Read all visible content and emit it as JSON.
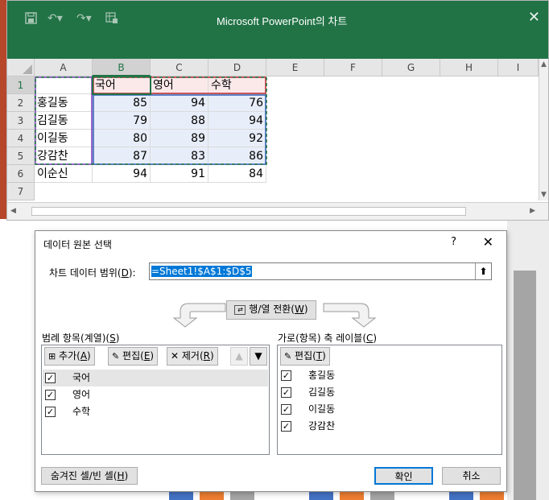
{
  "excel": {
    "title": "Microsoft PowerPoint의 차트",
    "columns": [
      "A",
      "B",
      "C",
      "D",
      "E",
      "F",
      "G",
      "H",
      "I"
    ],
    "rows": [
      "1",
      "2",
      "3",
      "4",
      "5",
      "6",
      "7"
    ],
    "cells": [
      [
        "",
        "국어",
        "영어",
        "수학"
      ],
      [
        "홍길동",
        "85",
        "94",
        "76"
      ],
      [
        "김길동",
        "79",
        "88",
        "94"
      ],
      [
        "이길동",
        "80",
        "89",
        "92"
      ],
      [
        "강감찬",
        "87",
        "83",
        "86"
      ],
      [
        "이순신",
        "94",
        "91",
        "84"
      ]
    ]
  },
  "dialog": {
    "title": "데이터 원본 선택",
    "help": "?",
    "close": "✕",
    "range_label": "차트 데이터 범위(",
    "range_label_key": "D",
    "range_label_end": "):",
    "range_value": "=Sheet1!$A$1:$D$5",
    "switch_label": "행/열 전환(",
    "switch_key": "W",
    "legend": {
      "header": "범례 항목(계열)(",
      "header_key": "S",
      "add": "추가(",
      "add_key": "A",
      "edit": "편집(",
      "edit_key": "E",
      "remove": "제거(",
      "remove_key": "R",
      "items": [
        "국어",
        "영어",
        "수학"
      ]
    },
    "axis": {
      "header": "가로(항목) 축 레이블(",
      "header_key": "C",
      "edit": "편집(",
      "edit_key": "T",
      "items": [
        "홍길동",
        "김길동",
        "이길동",
        "강감찬"
      ]
    },
    "hidden_btn": "숨겨진 셀/빈 셀(",
    "hidden_key": "H",
    "ok": "확인",
    "cancel": "취소"
  },
  "colors": {
    "excel_green": "#217346",
    "ppt_red": "#b7472a",
    "bar_blue": "#4472c4",
    "bar_orange": "#ed7d31",
    "bar_gray": "#a5a5a5"
  }
}
